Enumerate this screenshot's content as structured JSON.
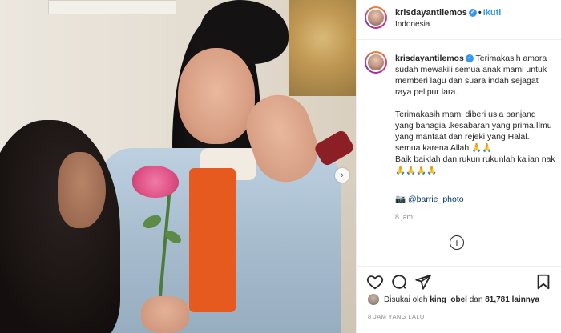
{
  "post": {
    "username": "krisdayantilemos",
    "follow_label": "Ikuti",
    "location": "Indonesia",
    "caption_text": "Terimakasih amora sudah mewakili semua anak mami untuk memberi lagu dan suara indah sejagat raya pelipur lara.\n\nTerimakasih mami diberi usia panjang yang bahagia .kesabaran yang prima,Ilmu yang manfaat dan rejeki yang Halal.\nsemua karena Allah 🙏🙏\nBaik baiklah dan rukun rukunlah kalian nak 🙏🙏🙏🙏",
    "credit": "📷 @barrie_photo",
    "time": "8 jam",
    "likes_prefix": "Disukai oleh",
    "likes_user": "king_obel",
    "likes_mid": "dan",
    "likes_count": "81,781",
    "likes_suffix": "lainnya",
    "posted_ago": "8 JAM YANG LALU",
    "add_comment_symbol": "+",
    "next_symbol": "›"
  },
  "icons": {
    "like": "heart-icon",
    "comment": "comment-icon",
    "share": "send-icon",
    "save": "bookmark-icon",
    "verified": "verified-icon",
    "next": "chevron-right-icon",
    "add": "plus-circle-icon"
  },
  "colors": {
    "link": "#3897f0",
    "text": "#262626",
    "muted": "#8e8e8e"
  }
}
